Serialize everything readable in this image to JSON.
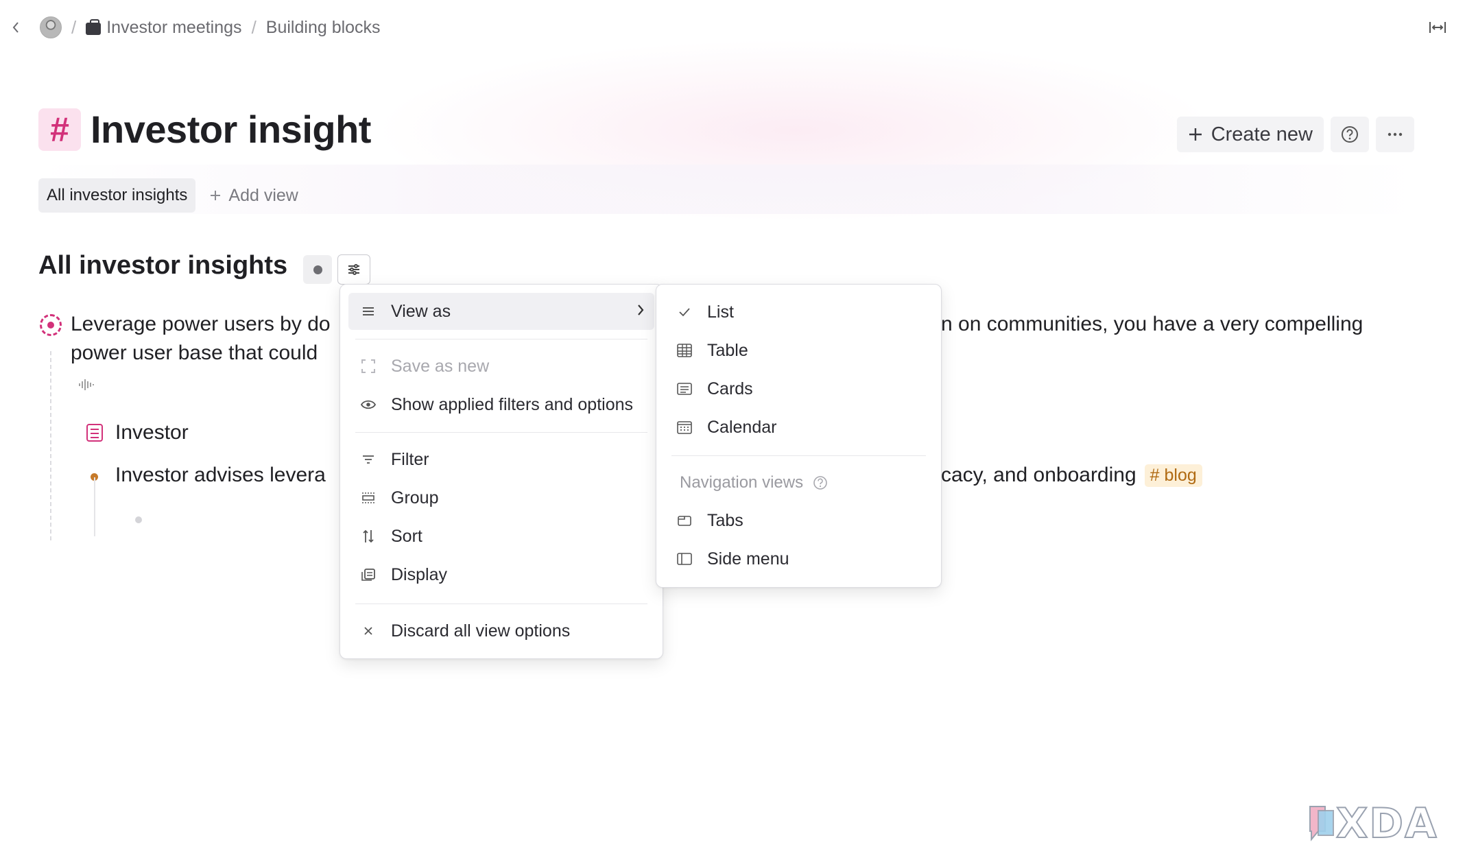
{
  "breadcrumb": {
    "parent": "Investor meetings",
    "current": "Building blocks"
  },
  "page": {
    "title": "Investor insight",
    "title_icon": "#",
    "accent": "#d2317a"
  },
  "actions": {
    "create_new": "Create new"
  },
  "views": {
    "active": "All investor insights",
    "add_view": "Add view"
  },
  "section": {
    "title": "All investor insights"
  },
  "content": {
    "line1_left": "Leverage power users by do",
    "line1_right": "n on communities, you have a very compelling",
    "line2": "power user base that could",
    "investor_label": "Investor",
    "advises_left": "Investor advises levera",
    "advises_right": "cacy, and onboarding",
    "tag": "# blog"
  },
  "options_menu": {
    "view_as": "View as",
    "save_as_new": "Save as new",
    "show_filters": "Show applied filters and options",
    "filter": "Filter",
    "group": "Group",
    "sort": "Sort",
    "display": "Display",
    "discard": "Discard all view options"
  },
  "view_as_menu": {
    "list": "List",
    "table": "Table",
    "cards": "Cards",
    "calendar": "Calendar",
    "nav_header": "Navigation views",
    "tabs": "Tabs",
    "side_menu": "Side menu",
    "selected": "List"
  },
  "watermark": "XDA"
}
